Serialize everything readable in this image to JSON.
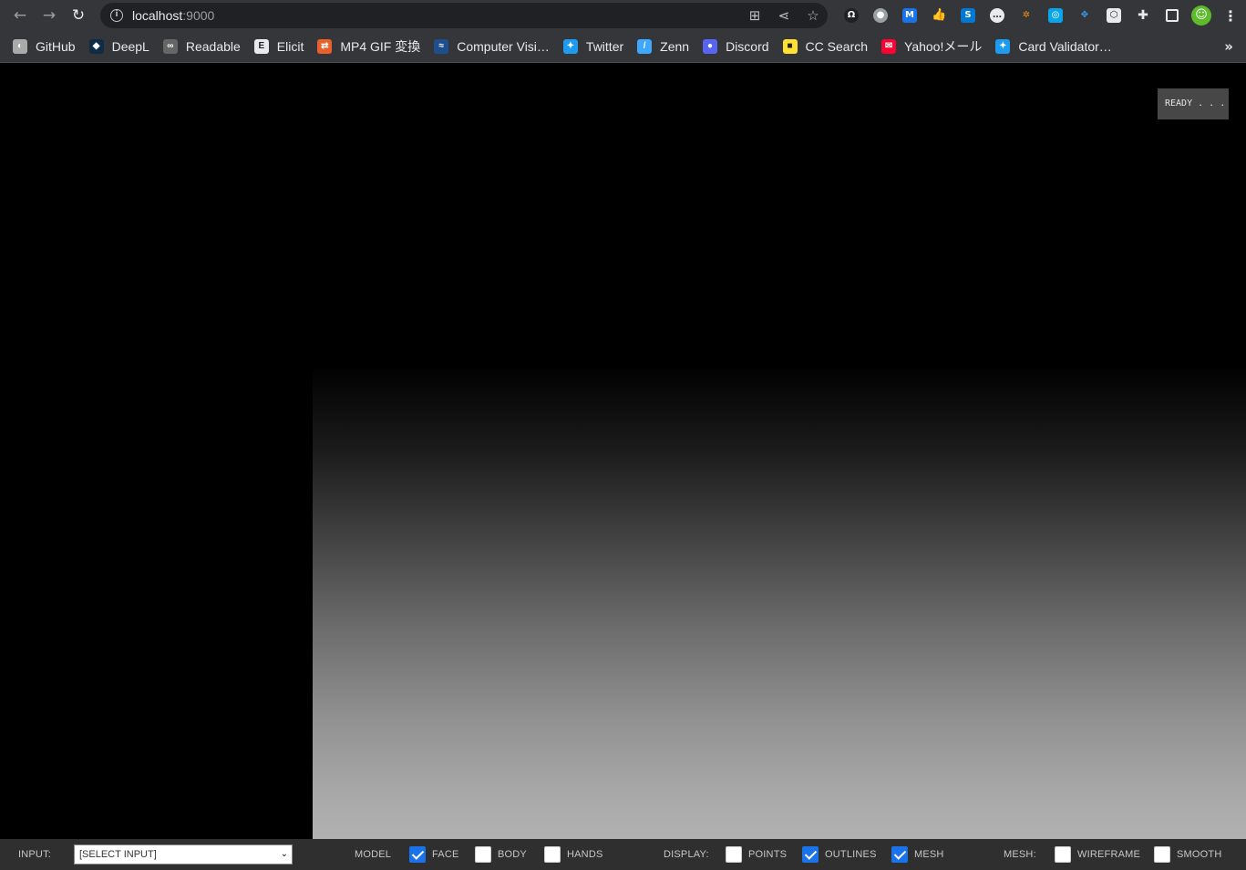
{
  "browser": {
    "url_host": "localhost",
    "url_port": ":9000",
    "bookmarks": [
      {
        "label": "GitHub",
        "icon": "github-icon",
        "color": "#aaaaaa",
        "glyph": "◐"
      },
      {
        "label": "DeepL",
        "icon": "deepl-icon",
        "color": "#0f2b46",
        "glyph": "◆"
      },
      {
        "label": "Readable",
        "icon": "glasses-icon",
        "color": "#666666",
        "glyph": "∞"
      },
      {
        "label": "Elicit",
        "icon": "elicit-icon",
        "color": "#e8eaed",
        "glyph": "E"
      },
      {
        "label": "MP4 GIF 変換",
        "icon": "convert-icon",
        "color": "#e8612c",
        "glyph": "⇄"
      },
      {
        "label": "Computer Visi…",
        "icon": "cv-icon",
        "color": "#1f4e8c",
        "glyph": "≈"
      },
      {
        "label": "Twitter",
        "icon": "twitter-icon",
        "color": "#1d9bf0",
        "glyph": "✦"
      },
      {
        "label": "Zenn",
        "icon": "zenn-icon",
        "color": "#3ea8ff",
        "glyph": "/"
      },
      {
        "label": "Discord",
        "icon": "discord-icon",
        "color": "#5865f2",
        "glyph": "●"
      },
      {
        "label": "CC Search",
        "icon": "cc-search-icon",
        "color": "#ffe033",
        "glyph": "■"
      },
      {
        "label": "Yahoo!メール",
        "icon": "yahoo-mail-icon",
        "color": "#ff0033",
        "glyph": "✉"
      },
      {
        "label": "Card Validator…",
        "icon": "twitter-icon",
        "color": "#1d9bf0",
        "glyph": "✦"
      }
    ],
    "more_label": "»"
  },
  "page": {
    "status_text": "READY . . ."
  },
  "controls": {
    "input_label": "INPUT:",
    "input_select_value": "[SELECT INPUT]",
    "model_label": "MODEL",
    "face_label": "FACE",
    "face_checked": true,
    "body_label": "BODY",
    "body_checked": false,
    "hands_label": "HANDS",
    "hands_checked": false,
    "display_label": "DISPLAY:",
    "points_label": "POINTS",
    "points_checked": false,
    "outlines_label": "OUTLINES",
    "outlines_checked": true,
    "mesh_label": "MESH",
    "mesh_checked": true,
    "mesh_section_label": "MESH:",
    "wireframe_label": "WIREFRAME",
    "wireframe_checked": false,
    "smooth_label": "SMOOTH",
    "smooth_checked": false
  }
}
